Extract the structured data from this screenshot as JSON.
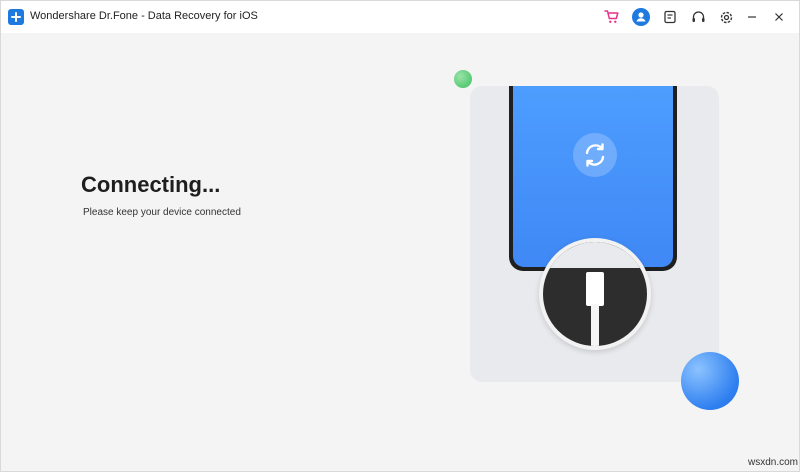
{
  "window": {
    "title": "Wondershare Dr.Fone - Data Recovery for iOS",
    "accent_color": "#1f7ae0"
  },
  "toolbar": {
    "icons": [
      "cart-icon",
      "user-icon",
      "feedback-icon",
      "support-headset-icon",
      "settings-gear-icon",
      "minimize-icon",
      "close-icon"
    ],
    "cart_color": "#e6338a",
    "avatar_color": "#1f7ae0"
  },
  "main": {
    "heading": "Connecting...",
    "subtext": "Please keep your device connected"
  },
  "illustration": {
    "icons": [
      "phone-icon",
      "sync-icon",
      "usb-cable-icon"
    ],
    "screen_color": "#4d9dff"
  },
  "watermark": "wsxdn.com"
}
